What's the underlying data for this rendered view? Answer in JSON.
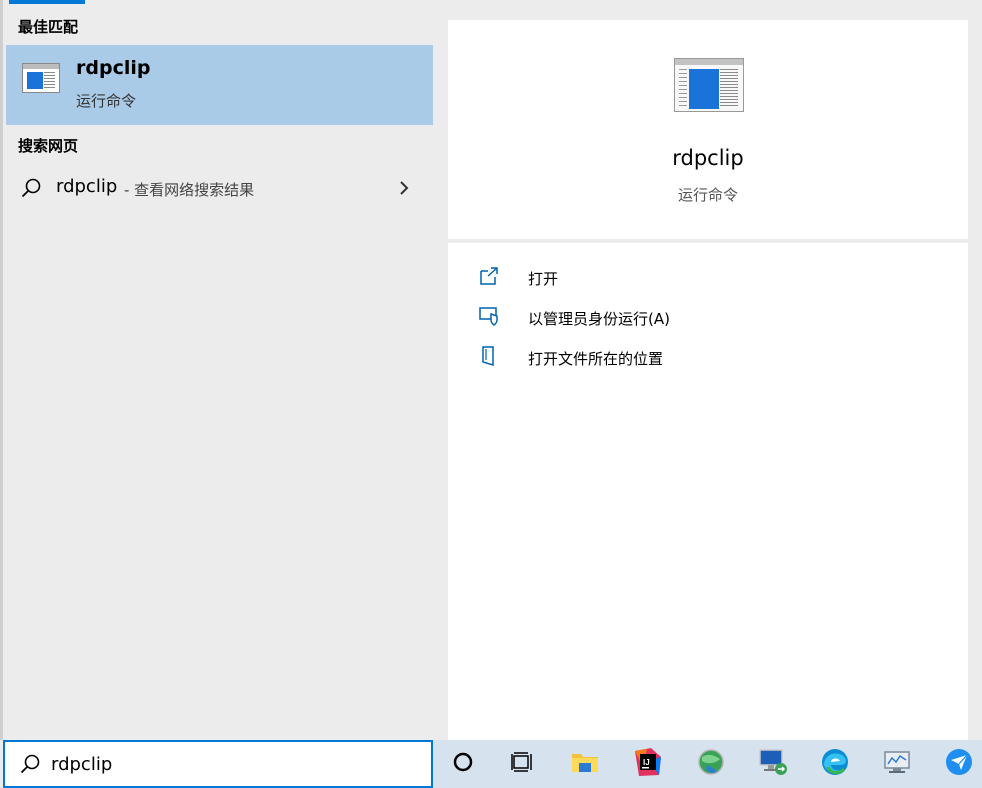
{
  "left": {
    "best_match_title": "最佳匹配",
    "best_match": {
      "name": "rdpclip",
      "type": "运行命令"
    },
    "web_title": "搜索网页",
    "web_result": {
      "term": "rdpclip",
      "hint": "- 查看网络搜索结果"
    }
  },
  "right": {
    "app_name": "rdpclip",
    "app_type": "运行命令",
    "actions": [
      {
        "label": "打开",
        "icon": "open-icon"
      },
      {
        "label": "以管理员身份运行(A)",
        "icon": "shield-run-icon"
      },
      {
        "label": "打开文件所在的位置",
        "icon": "file-location-icon"
      }
    ]
  },
  "search": {
    "value": "rdpclip"
  },
  "taskbar": {
    "items": [
      "cortana-icon",
      "task-view-icon",
      "file-explorer-icon",
      "intellij-icon",
      "globe-app-icon",
      "remote-desktop-icon",
      "edge-icon",
      "monitor-app-icon",
      "paper-plane-app-icon"
    ]
  },
  "colors": {
    "accent": "#0078d7",
    "selected": "#a9cbe7",
    "taskbar": "#d6e2ed"
  }
}
